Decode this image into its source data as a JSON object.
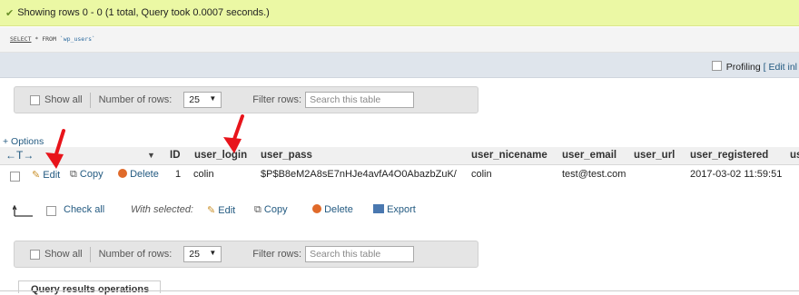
{
  "success": {
    "message": "Showing rows 0 - 0 (1 total, Query took 0.0007 seconds.)"
  },
  "sql": {
    "select": "SELECT",
    "star_from": "* FROM",
    "table": "`wp_users`"
  },
  "profiling": {
    "label": "Profiling",
    "edit_link": "[ Edit inl"
  },
  "navbar": {
    "show_all": "Show all",
    "number_of_rows": "Number of rows:",
    "rows_value": "25",
    "filter_label": "Filter rows:",
    "search_placeholder": "Search this table"
  },
  "options_link": "+ Options",
  "table": {
    "leftright": "←T→",
    "columns": [
      "ID",
      "user_login",
      "user_pass",
      "user_nicename",
      "user_email",
      "user_url",
      "user_registered",
      "us"
    ],
    "row": {
      "edit": "Edit",
      "copy": "Copy",
      "delete": "Delete",
      "ID": "1",
      "user_login": "colin",
      "user_pass": "$P$B8eM2A8sE7nHJe4avfA4O0AbazbZuK/",
      "user_nicename": "colin",
      "user_email": "test@test.com",
      "user_registered": "2017-03-02 11:59:51"
    }
  },
  "actions": {
    "check_all": "Check all",
    "with_selected": "With selected:",
    "edit": "Edit",
    "copy": "Copy",
    "delete": "Delete",
    "export": "Export"
  },
  "query_ops_tab": "Query results operations"
}
